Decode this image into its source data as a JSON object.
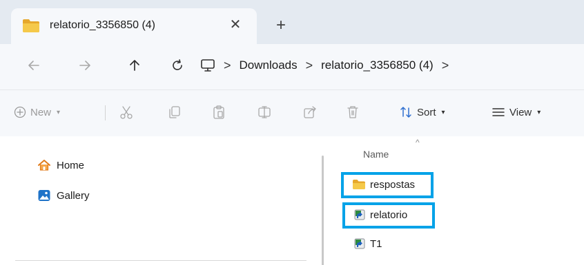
{
  "window": {
    "tab_title": "relatorio_3356850 (4)",
    "tab_close_glyph": "✕",
    "new_tab_glyph": "+",
    "tab_icon": "folder-icon"
  },
  "navigation": {
    "back_icon": "arrow-left-icon",
    "forward_icon": "arrow-right-icon",
    "up_icon": "arrow-up-icon",
    "refresh_icon": "refresh-icon",
    "monitor_icon": "this-pc-icon",
    "breadcrumbs": [
      "Downloads",
      "relatorio_3356850 (4)"
    ],
    "separator": ">"
  },
  "commandbar": {
    "new_label": "New",
    "sort_label": "Sort",
    "view_label": "View",
    "icons": [
      "cut-icon",
      "copy-icon",
      "paste-icon",
      "rename-icon",
      "share-icon",
      "delete-icon"
    ]
  },
  "sidebar": {
    "items": [
      {
        "label": "Home",
        "icon": "home-icon"
      },
      {
        "label": "Gallery",
        "icon": "gallery-icon"
      }
    ]
  },
  "filelist": {
    "column_header": "Name",
    "items": [
      {
        "name": "respostas",
        "icon": "folder-icon",
        "highlighted": true
      },
      {
        "name": "relatorio",
        "icon": "shortcut-file-icon",
        "highlighted": true
      },
      {
        "name": "T1",
        "icon": "shortcut-file-icon",
        "highlighted": false
      }
    ]
  },
  "colors": {
    "highlight": "#00a2e8",
    "folder": "#f2c14e",
    "chrome_background": "#e4eaf1"
  }
}
